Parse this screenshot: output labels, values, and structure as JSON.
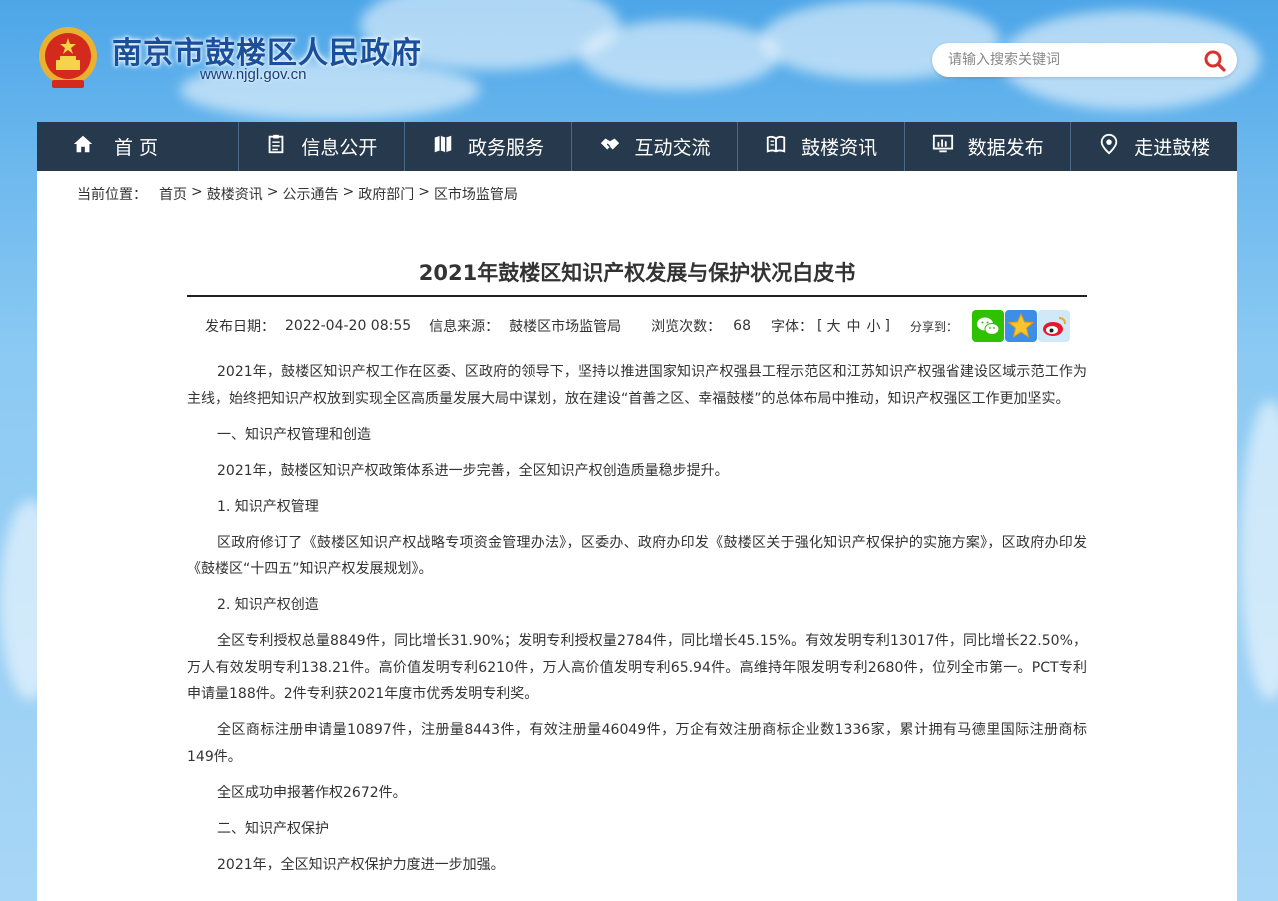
{
  "header": {
    "site_title": "南京市鼓楼区人民政府",
    "site_url": "www.njgl.gov.cn",
    "search_placeholder": "请输入搜索关键词"
  },
  "nav": [
    {
      "label": "首 页",
      "icon": "home-icon"
    },
    {
      "label": "信息公开",
      "icon": "document-icon"
    },
    {
      "label": "政务服务",
      "icon": "map-icon"
    },
    {
      "label": "互动交流",
      "icon": "handshake-icon"
    },
    {
      "label": "鼓楼资讯",
      "icon": "book-icon"
    },
    {
      "label": "数据发布",
      "icon": "monitor-chart-icon"
    },
    {
      "label": "走进鼓楼",
      "icon": "location-pin-icon"
    }
  ],
  "breadcrumb": {
    "prefix": "当前位置：",
    "items": [
      "首页",
      "鼓楼资讯",
      "公示通告",
      "政府部门",
      "区市场监管局"
    ],
    "separator": ">"
  },
  "article": {
    "title": "2021年鼓楼区知识产权发展与保护状况白皮书",
    "meta": {
      "date_label": "发布日期：",
      "date": "2022-04-20 08:55",
      "source_label": "信息来源：",
      "source": "鼓楼区市场监管局",
      "views_label": "浏览次数：",
      "views": "68",
      "font_label": "字体：",
      "font_open": "[",
      "font_large": "大",
      "font_medium": "中",
      "font_small": "小",
      "font_close": "]",
      "share_label": "分享到："
    },
    "paragraphs": [
      "2021年，鼓楼区知识产权工作在区委、区政府的领导下，坚持以推进国家知识产权强县工程示范区和江苏知识产权强省建设区域示范工作为主线，始终把知识产权放到实现全区高质量发展大局中谋划，放在建设“首善之区、幸福鼓楼”的总体布局中推动，知识产权强区工作更加坚实。",
      "一、知识产权管理和创造",
      "2021年，鼓楼区知识产权政策体系进一步完善，全区知识产权创造质量稳步提升。",
      "1. 知识产权管理",
      "区政府修订了《鼓楼区知识产权战略专项资金管理办法》，区委办、政府办印发《鼓楼区关于强化知识产权保护的实施方案》，区政府办印发《鼓楼区“十四五”知识产权发展规划》。",
      "2. 知识产权创造",
      "全区专利授权总量8849件，同比增长31.90%；发明专利授权量2784件，同比增长45.15%。有效发明专利13017件，同比增长22.50%，万人有效发明专利138.21件。高价值发明专利6210件，万人高价值发明专利65.94件。高维持年限发明专利2680件，位列全市第一。PCT专利申请量188件。2件专利获2021年度市优秀发明专利奖。",
      "全区商标注册申请量10897件，注册量8443件，有效注册量46049件，万企有效注册商标企业数1336家，累计拥有马德里国际注册商标149件。",
      "全区成功申报著作权2672件。",
      "二、知识产权保护",
      "2021年，全区知识产权保护力度进一步加强。"
    ]
  },
  "colors": {
    "nav_bg": "#27394c",
    "title_blue": "#1a4f9c",
    "search_icon": "#d9322e"
  }
}
